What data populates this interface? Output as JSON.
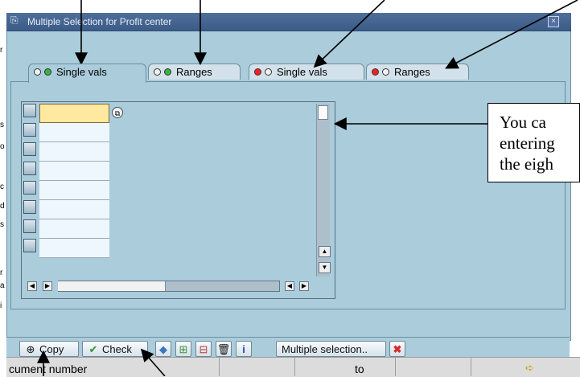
{
  "window": {
    "title": "Multiple Selection for Profit center"
  },
  "left_strip_chars": [
    "r",
    "s",
    "o",
    "c",
    "d",
    "s",
    "r",
    "a",
    "i"
  ],
  "tabs": [
    {
      "label": "Single vals",
      "lights": [
        "#f2f2f2",
        "#36b341"
      ],
      "active": true
    },
    {
      "label": "Ranges",
      "lights": [
        "#f2f2f2",
        "#36b341"
      ],
      "active": false
    },
    {
      "label": "Single vals",
      "lights": [
        "#f2f2f2",
        "#ff1f1f"
      ],
      "active": false
    },
    {
      "label": "Ranges",
      "lights": [
        "#f2f2f2",
        "#ff1f1f"
      ],
      "active": false
    }
  ],
  "table": {
    "rows": 8,
    "values": [
      "",
      "",
      "",
      "",
      "",
      "",
      "",
      ""
    ],
    "value_help_icon": "value-help-icon"
  },
  "toolbar": {
    "copy_label": "Copy",
    "check_label": "Check",
    "multiple_selection_label": "Multiple selection..",
    "icons": [
      "execute-icon",
      "check-icon",
      "import-icon",
      "insert-row-icon",
      "delete-row-icon",
      "trash-icon",
      "info-icon",
      "cancel-icon"
    ]
  },
  "status": {
    "left_text": "cument number",
    "to_text": "to"
  },
  "callout": {
    "lines": [
      "You ca",
      "entering",
      "the eigh"
    ]
  },
  "colors": {
    "dialog_bg": "#aaccdb",
    "title_bar": "#3c5b87",
    "active_cell": "#ffe8a0",
    "green_light": "#36b341",
    "red_light": "#ff1f1f"
  }
}
